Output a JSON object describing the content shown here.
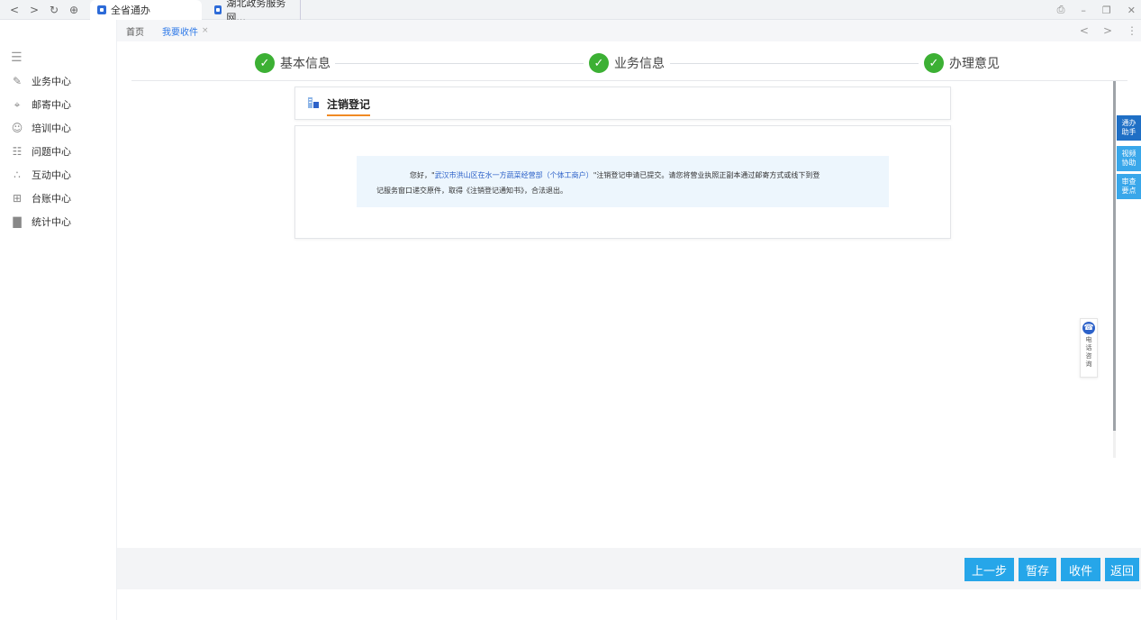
{
  "browser": {
    "tabs": [
      {
        "label": "全省通办"
      },
      {
        "label": "湖北政务服务网..."
      }
    ]
  },
  "sidebar": {
    "items": [
      {
        "label": "业务中心",
        "icon": "pencil-icon"
      },
      {
        "label": "邮寄中心",
        "icon": "location-icon"
      },
      {
        "label": "培训中心",
        "icon": "users-icon"
      },
      {
        "label": "问题中心",
        "icon": "document-icon"
      },
      {
        "label": "互动中心",
        "icon": "network-icon"
      },
      {
        "label": "台账中心",
        "icon": "grid-icon"
      },
      {
        "label": "统计中心",
        "icon": "bar-chart-icon"
      }
    ]
  },
  "page_tabs": [
    {
      "label": "首页"
    },
    {
      "label": "我要收件",
      "close": "×"
    }
  ],
  "stepper": {
    "steps": [
      {
        "label": "基本信息",
        "status": "done"
      },
      {
        "label": "业务信息",
        "status": "done"
      },
      {
        "label": "办理意见",
        "status": "done"
      }
    ]
  },
  "section": {
    "title": "注销登记"
  },
  "message": {
    "prefix": "您好，\"",
    "company": "武汉市洪山区在水一方蔬菜经营部（个体工商户）",
    "line1_rest": "\"注销登记申请已提交。请您将营业执照正副本通过邮寄方式或线下到登",
    "line2": "记服务窗口递交原件，取得《注销登记通知书》，合法退出。"
  },
  "side_tools": [
    {
      "label": "通办助手",
      "color": "#1f6fc5"
    },
    {
      "label": "视频协助",
      "color": "#39a7ea"
    },
    {
      "label": "审查要点",
      "color": "#39a7ea"
    }
  ],
  "phone_consult": {
    "label": "电话咨询"
  },
  "footer": {
    "buttons": [
      {
        "label": "上一步"
      },
      {
        "label": "暂存"
      },
      {
        "label": "收件"
      },
      {
        "label": "返回"
      }
    ]
  },
  "colors": {
    "accent": "#26a6e9",
    "check_green": "#3cb034",
    "title_underline": "#f08a24",
    "company_link": "#2d62c9"
  }
}
